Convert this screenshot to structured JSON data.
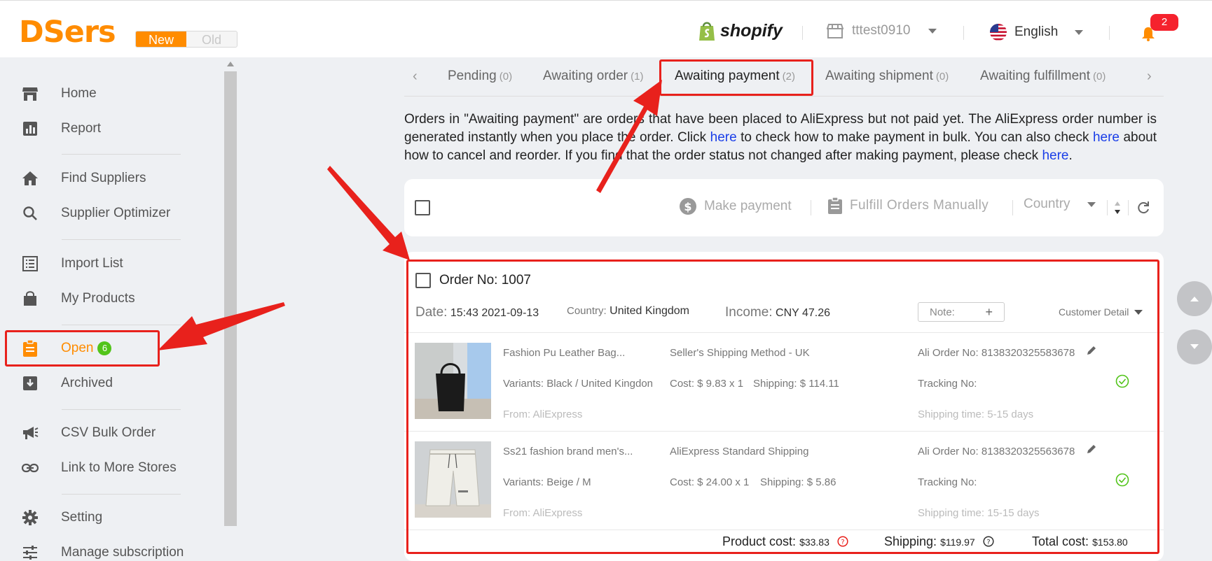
{
  "header": {
    "logo": "DSers",
    "toggle_new": "New",
    "toggle_old": "Old",
    "platform": "shopify",
    "store_name": "tttest0910",
    "language": "English",
    "notification_count": "2",
    "brand_color": "#ff8c00"
  },
  "sidebar": {
    "items": [
      {
        "label": "Home",
        "icon": "store-icon"
      },
      {
        "label": "Report",
        "icon": "chart-icon"
      },
      {
        "label": "Find Suppliers",
        "icon": "house-icon"
      },
      {
        "label": "Supplier Optimizer",
        "icon": "search-icon"
      },
      {
        "label": "Import List",
        "icon": "list-icon"
      },
      {
        "label": "My Products",
        "icon": "bag-icon"
      },
      {
        "label": "Open",
        "icon": "clipboard-icon",
        "count": "6",
        "active": true
      },
      {
        "label": "Archived",
        "icon": "archive-icon"
      },
      {
        "label": "CSV Bulk Order",
        "icon": "megaphone-icon"
      },
      {
        "label": "Link to More Stores",
        "icon": "link-icon"
      },
      {
        "label": "Setting",
        "icon": "gear-icon"
      },
      {
        "label": "Manage subscription",
        "icon": "sliders-icon"
      }
    ]
  },
  "tabs": [
    {
      "label": "Pending",
      "count": "(0)"
    },
    {
      "label": "Awaiting order",
      "count": "(1)"
    },
    {
      "label": "Awaiting payment",
      "count": "(2)",
      "active": true
    },
    {
      "label": "Awaiting shipment",
      "count": "(0)"
    },
    {
      "label": "Awaiting fulfillment",
      "count": "(0)"
    }
  ],
  "description": {
    "part1": "Orders in \"Awaiting payment\" are orders that have been placed to AliExpress but not paid yet. The AliExpress order number is generated instantly when you place the order. Click ",
    "link1": "here",
    "part2": " to check how to make payment in bulk. You can also check ",
    "link2": "here",
    "part3": " about how to cancel and reorder. If you find that the order status not changed after making payment, please check ",
    "link3": "here",
    "part4": "."
  },
  "actions": {
    "make_payment": "Make payment",
    "fulfill_manually": "Fulfill Orders Manually",
    "country": "Country"
  },
  "order": {
    "title": "Order No: 1007",
    "date_label": "Date:",
    "date_value": "15:43 2021-09-13",
    "country_label": "Country:",
    "country_value": "United Kingdom",
    "income_label": "Income:",
    "income_value": "CNY 47.26",
    "note_label": "Note:",
    "customer_detail": "Customer Detail",
    "products": [
      {
        "name": "Fashion Pu Leather Bag...",
        "variants": "Variants: Black / United Kingdon",
        "from": "From: AliExpress",
        "shipping_method": "Seller's Shipping Method - UK",
        "cost": "Cost: $ 9.83 x 1",
        "shipping": "Shipping: $ 114.11",
        "ali_order": "Ali Order No: 8138320325583678",
        "tracking": "Tracking No:",
        "shipping_time": "Shipping time: 5-15 days"
      },
      {
        "name": "Ss21 fashion brand men's...",
        "variants": "Variants: Beige / M",
        "from": "From: AliExpress",
        "shipping_method": "AliExpress Standard Shipping",
        "cost": "Cost: $ 24.00 x 1",
        "shipping": "Shipping: $ 5.86",
        "ali_order": "Ali Order No: 8138320325563678",
        "tracking": "Tracking No:",
        "shipping_time": "Shipping time: 15-15 days"
      }
    ],
    "product_cost_label": "Product cost:",
    "product_cost_value": "$33.83",
    "shipping_label": "Shipping:",
    "shipping_value": "$119.97",
    "total_label": "Total cost:",
    "total_value": "$153.80"
  }
}
